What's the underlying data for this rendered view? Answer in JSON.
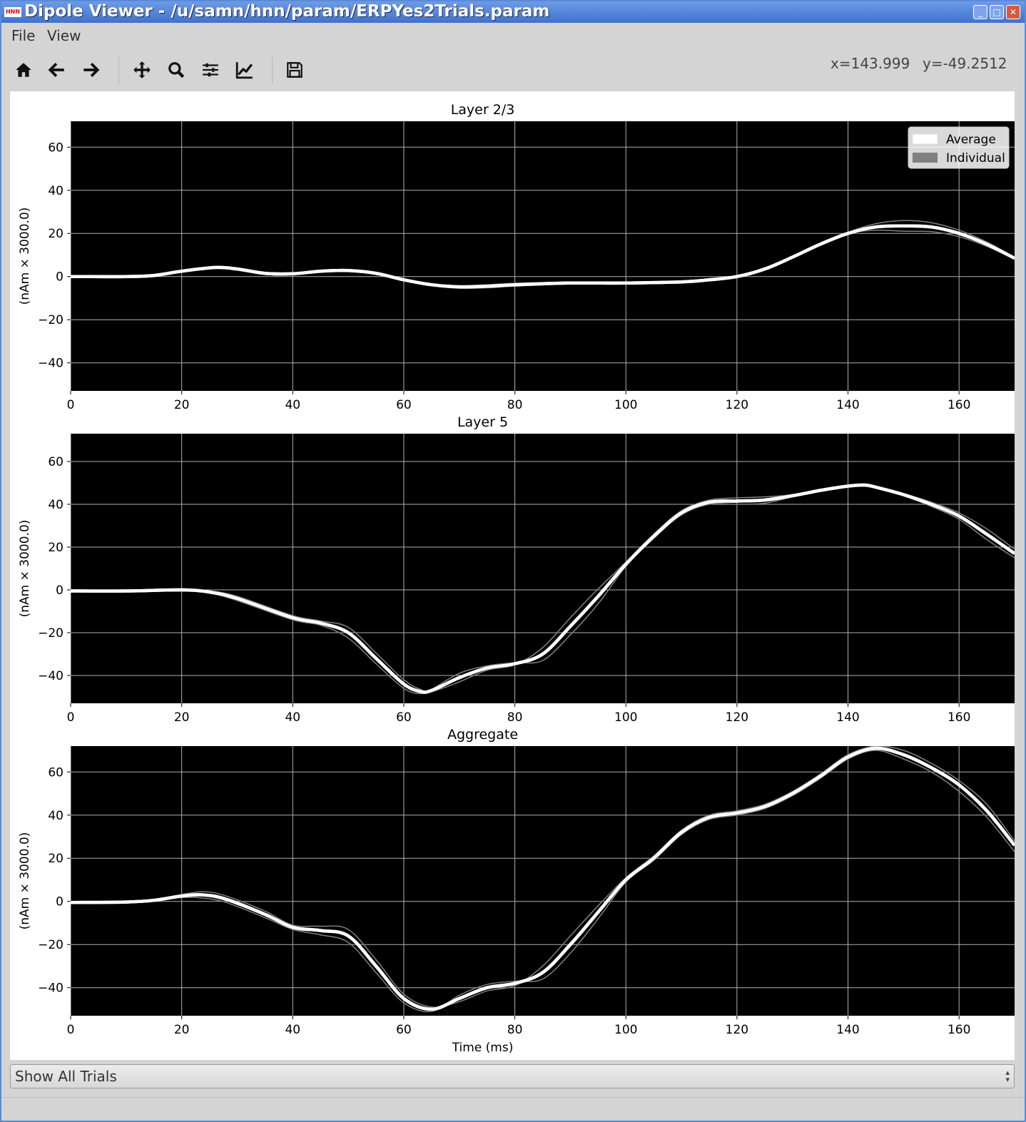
{
  "window": {
    "title": "Dipole Viewer - /u/samn/hnn/param/ERPYes2Trials.param",
    "app_icon_label": "HNN",
    "buttons": {
      "minimize": "_",
      "maximize": "□",
      "close": "✕"
    }
  },
  "menu": [
    {
      "label": "File"
    },
    {
      "label": "View"
    }
  ],
  "toolbar": {
    "tools": [
      "home-icon",
      "back-arrow-icon",
      "forward-arrow-icon",
      "pan-icon",
      "zoom-icon",
      "subplots-config-icon",
      "edit-axes-icon",
      "save-icon"
    ],
    "x_readout": "x=143.999",
    "y_readout": "y=-49.2512"
  },
  "colors": {
    "plot_background": "#000000",
    "average_line": "#ffffff",
    "individual_line": "#808080",
    "grid": "#b0b0b0"
  },
  "chart_data": [
    {
      "type": "line",
      "title": "Layer 2/3",
      "xlabel": "",
      "ylabel": "(nAm × 3000.0)",
      "xlim": [
        0,
        170
      ],
      "ylim": [
        -53,
        72
      ],
      "xticks": [
        0,
        20,
        40,
        60,
        80,
        100,
        120,
        140,
        160
      ],
      "yticks": [
        -40,
        -20,
        0,
        20,
        40,
        60
      ],
      "grid": true,
      "legend": {
        "placement": "top-right",
        "entries": [
          "Average",
          "Individual"
        ]
      },
      "series": [
        {
          "name": "Average",
          "x": [
            0,
            10,
            15,
            20,
            26,
            30,
            35,
            40,
            45,
            50,
            55,
            60,
            65,
            70,
            75,
            80,
            90,
            100,
            110,
            115,
            120,
            125,
            130,
            135,
            140,
            145,
            150,
            155,
            160,
            165,
            170
          ],
          "values": [
            0,
            0,
            0.5,
            2.5,
            4.2,
            3.5,
            1.5,
            1.3,
            2.5,
            2.8,
            1.5,
            -1.5,
            -3.8,
            -4.8,
            -4.5,
            -3.8,
            -3,
            -3,
            -2.5,
            -1.5,
            0,
            3.5,
            9,
            15,
            20,
            23,
            23.5,
            23,
            20,
            15,
            8.5
          ]
        },
        {
          "name": "Individual",
          "x": [
            0,
            10,
            15,
            20,
            26,
            30,
            35,
            40,
            45,
            50,
            55,
            60,
            65,
            70,
            75,
            80,
            90,
            100,
            110,
            115,
            120,
            125,
            130,
            135,
            140,
            145,
            150,
            155,
            160,
            165,
            170
          ],
          "values": [
            0,
            0,
            0.4,
            2.2,
            4.0,
            3.3,
            1.3,
            1.1,
            2.3,
            2.6,
            1.3,
            -1.8,
            -4.2,
            -5.4,
            -5.2,
            -4.5,
            -3.4,
            -3.2,
            -2.7,
            -1.7,
            -0.2,
            3.2,
            8.6,
            14.6,
            20.5,
            24.5,
            26,
            25,
            21.5,
            16,
            9
          ]
        },
        {
          "name": "Individual",
          "x": [
            0,
            10,
            15,
            20,
            26,
            30,
            35,
            40,
            45,
            50,
            55,
            60,
            65,
            70,
            75,
            80,
            90,
            100,
            110,
            115,
            120,
            125,
            130,
            135,
            140,
            145,
            150,
            155,
            160,
            165,
            170
          ],
          "values": [
            0,
            0,
            0.6,
            2.8,
            4.4,
            3.7,
            1.7,
            1.5,
            2.7,
            3.0,
            1.7,
            -1.2,
            -3.4,
            -4.2,
            -3.8,
            -3.1,
            -2.6,
            -2.8,
            -2.3,
            -1.3,
            0.2,
            3.8,
            9.4,
            15.4,
            20,
            21.5,
            21,
            20.8,
            18.5,
            14,
            8
          ]
        }
      ]
    },
    {
      "type": "line",
      "title": "Layer 5",
      "xlabel": "",
      "ylabel": "(nAm × 3000.0)",
      "xlim": [
        0,
        170
      ],
      "ylim": [
        -53,
        73
      ],
      "xticks": [
        0,
        20,
        40,
        60,
        80,
        100,
        120,
        140,
        160
      ],
      "yticks": [
        -40,
        -20,
        0,
        20,
        40,
        60
      ],
      "grid": true,
      "series": [
        {
          "name": "Average",
          "x": [
            0,
            10,
            20,
            25,
            30,
            40,
            45,
            50,
            55,
            60,
            63,
            65,
            70,
            75,
            80,
            85,
            90,
            95,
            100,
            105,
            110,
            115,
            120,
            125,
            130,
            135,
            140,
            143,
            145,
            150,
            155,
            160,
            165,
            170
          ],
          "values": [
            -0.5,
            -0.5,
            0,
            -1,
            -4,
            -13,
            -15.5,
            -20,
            -32,
            -44,
            -47.5,
            -47,
            -41,
            -36.5,
            -34.5,
            -30,
            -17,
            -3,
            12,
            25,
            36,
            41,
            41.5,
            42,
            44,
            46.5,
            48.5,
            49,
            48,
            44.5,
            40,
            34.5,
            26,
            17
          ]
        },
        {
          "name": "Individual",
          "x": [
            0,
            10,
            20,
            25,
            30,
            40,
            45,
            50,
            55,
            60,
            63,
            65,
            70,
            75,
            80,
            85,
            90,
            95,
            100,
            105,
            110,
            115,
            120,
            125,
            130,
            135,
            140,
            143,
            145,
            150,
            155,
            160,
            165,
            170
          ],
          "values": [
            -0.5,
            -0.5,
            0.3,
            -0.5,
            -3,
            -12,
            -14.5,
            -17.5,
            -29.5,
            -42,
            -46.5,
            -47.5,
            -43,
            -37.5,
            -35,
            -27,
            -13,
            0.5,
            13,
            26,
            37,
            42,
            43,
            43.5,
            44.5,
            47,
            49,
            49,
            48.2,
            45,
            41,
            36,
            28.5,
            19
          ]
        },
        {
          "name": "Individual",
          "x": [
            0,
            10,
            20,
            25,
            30,
            40,
            45,
            50,
            55,
            60,
            63,
            65,
            70,
            75,
            80,
            85,
            90,
            95,
            100,
            105,
            110,
            115,
            120,
            125,
            130,
            135,
            140,
            143,
            145,
            150,
            155,
            160,
            165,
            170
          ],
          "values": [
            -0.5,
            -0.5,
            -0.3,
            -1.5,
            -5,
            -14,
            -16.5,
            -22.5,
            -34.5,
            -46,
            -48.5,
            -46.5,
            -39,
            -35.5,
            -34,
            -33,
            -21,
            -6.5,
            11,
            24,
            35,
            40,
            40,
            40.5,
            43.5,
            46,
            48,
            49,
            47.8,
            44,
            39,
            33,
            23.5,
            15
          ]
        }
      ]
    },
    {
      "type": "line",
      "title": "Aggregate",
      "xlabel": "Time (ms)",
      "ylabel": "(nAm × 3000.0)",
      "xlim": [
        0,
        170
      ],
      "ylim": [
        -53,
        72
      ],
      "xticks": [
        0,
        20,
        40,
        60,
        80,
        100,
        120,
        140,
        160
      ],
      "yticks": [
        -40,
        -20,
        0,
        20,
        40,
        60
      ],
      "grid": true,
      "series": [
        {
          "name": "Average",
          "x": [
            0,
            10,
            15,
            20,
            24,
            28,
            35,
            40,
            45,
            50,
            55,
            60,
            65,
            70,
            75,
            80,
            85,
            90,
            95,
            100,
            105,
            110,
            115,
            120,
            125,
            130,
            135,
            140,
            145,
            150,
            155,
            160,
            165,
            170
          ],
          "values": [
            -0.5,
            -0.3,
            0.5,
            2.5,
            3,
            1,
            -6,
            -12,
            -13.5,
            -16,
            -30,
            -45,
            -50,
            -45,
            -40,
            -38,
            -33,
            -20,
            -5,
            10,
            20,
            32,
            39,
            41,
            44,
            50,
            58,
            67,
            71,
            68,
            62,
            54,
            42,
            26
          ]
        },
        {
          "name": "Individual",
          "x": [
            0,
            10,
            15,
            20,
            24,
            28,
            35,
            40,
            45,
            50,
            55,
            60,
            65,
            70,
            75,
            80,
            85,
            90,
            95,
            100,
            105,
            110,
            115,
            120,
            125,
            130,
            135,
            140,
            145,
            150,
            155,
            160,
            165,
            170
          ],
          "values": [
            -0.5,
            -0.3,
            0.7,
            3.2,
            4.5,
            2.5,
            -4.5,
            -11,
            -11.5,
            -13,
            -27,
            -43,
            -49,
            -46.5,
            -41.5,
            -39,
            -30,
            -16,
            -2,
            11,
            21,
            33,
            40,
            42,
            45,
            51,
            59,
            68,
            72,
            70,
            64,
            56,
            45,
            28
          ]
        },
        {
          "name": "Individual",
          "x": [
            0,
            10,
            15,
            20,
            24,
            28,
            35,
            40,
            45,
            50,
            55,
            60,
            65,
            70,
            75,
            80,
            85,
            90,
            95,
            100,
            105,
            110,
            115,
            120,
            125,
            130,
            135,
            140,
            145,
            150,
            155,
            160,
            165,
            170
          ],
          "values": [
            -0.5,
            -0.3,
            0.3,
            1.8,
            1.5,
            -0.5,
            -7.5,
            -13,
            -15.5,
            -19,
            -33,
            -47,
            -51,
            -43.5,
            -38.5,
            -37,
            -36,
            -24,
            -8,
            9,
            19,
            31,
            38,
            40,
            43,
            49,
            57,
            66,
            70,
            66,
            60,
            51,
            39,
            23
          ]
        }
      ]
    }
  ],
  "trial_select": {
    "value": "Show All Trials"
  }
}
